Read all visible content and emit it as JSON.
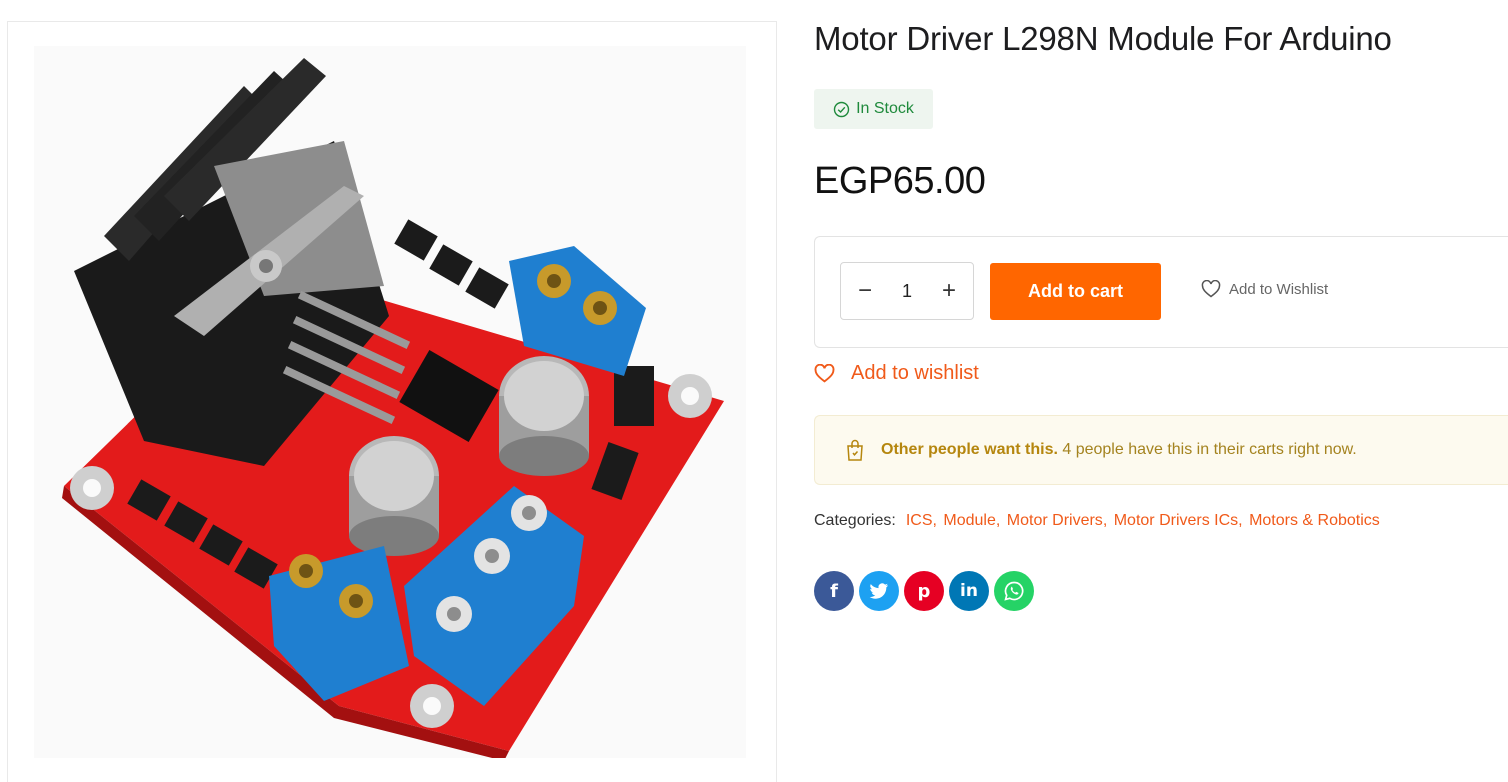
{
  "product": {
    "title": "Motor Driver L298N Module For Arduino",
    "stock_label": "In Stock",
    "price": "EGP65.00",
    "quantity": "1",
    "add_to_cart_label": "Add to cart",
    "add_to_wishlist_inline": "Add to Wishlist",
    "add_to_wishlist_link": "Add to wishlist"
  },
  "notice": {
    "strong": "Other people want this.",
    "text": "4 people have this in their carts right now."
  },
  "categories": {
    "label": "Categories:",
    "items": [
      "ICS",
      "Module",
      "Motor Drivers",
      "Motor Drivers ICs",
      "Motors & Robotics"
    ]
  },
  "social": [
    {
      "name": "facebook-icon",
      "color": "#3b5998",
      "glyph": "f"
    },
    {
      "name": "twitter-icon",
      "color": "#1da1f2",
      "glyph": "t"
    },
    {
      "name": "pinterest-icon",
      "color": "#e60023",
      "glyph": "p"
    },
    {
      "name": "linkedin-icon",
      "color": "#0077b5",
      "glyph": "in"
    },
    {
      "name": "whatsapp-icon",
      "color": "#25d366",
      "glyph": "w"
    }
  ],
  "colors": {
    "accent": "#ff6600",
    "link": "#f05a1a",
    "stock_green": "#1f8a3c"
  }
}
